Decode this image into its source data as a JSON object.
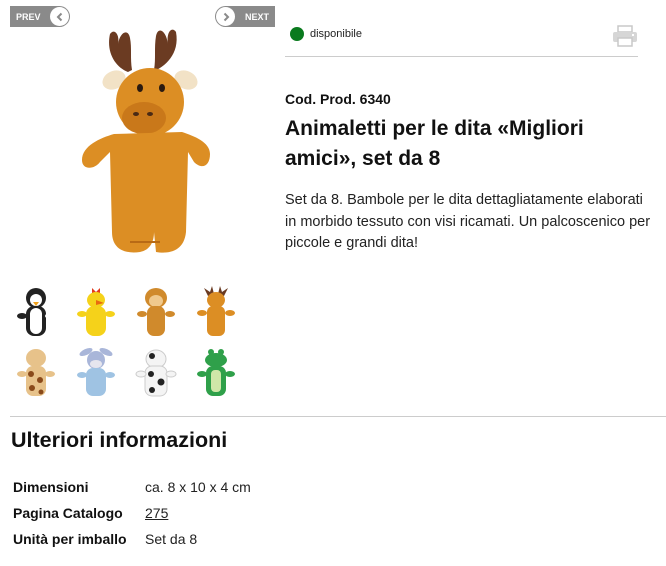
{
  "nav": {
    "prev_label": "PREV",
    "next_label": "NEXT"
  },
  "product": {
    "availability": "disponibile",
    "availability_color": "#0a7a1e",
    "code": "Cod. Prod. 6340",
    "title": "Animaletti per le dita «Migliori amici», set da 8",
    "description": "Set da 8. Bambole per le dita dettagliatamente elaborati in morbido tessuto con visi ricamati. Un palcoscenico per piccole e grandi dita!"
  },
  "thumbnails": [
    {
      "name": "penguin"
    },
    {
      "name": "chicken"
    },
    {
      "name": "monkey"
    },
    {
      "name": "moose"
    },
    {
      "name": "giraffe"
    },
    {
      "name": "donkey"
    },
    {
      "name": "cow"
    },
    {
      "name": "crocodile"
    }
  ],
  "more_info": {
    "title": "Ulteriori informazioni",
    "rows": [
      {
        "label": "Dimensioni",
        "value": "ca. 8 x 10 x 4 cm"
      },
      {
        "label": "Pagina Catalogo",
        "value": "275"
      },
      {
        "label": "Unità per imballo",
        "value": "Set da 8"
      }
    ]
  }
}
